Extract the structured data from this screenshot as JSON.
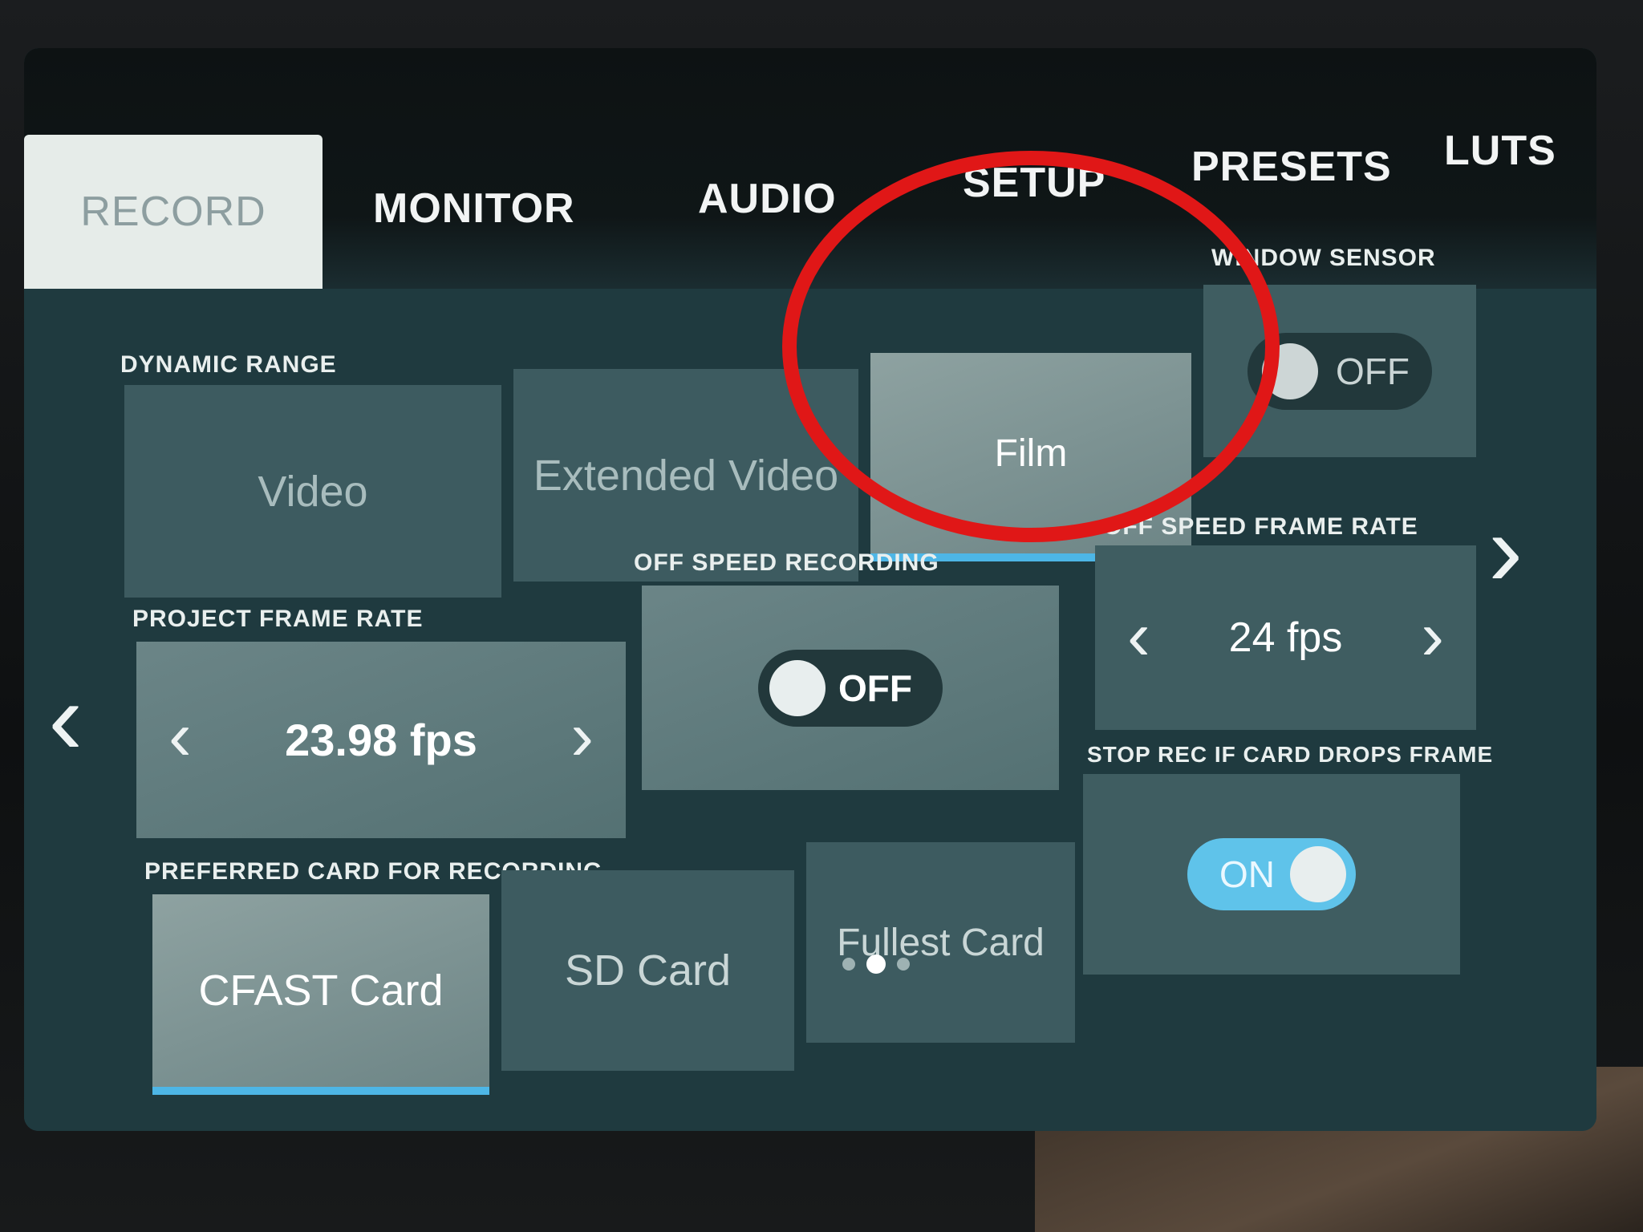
{
  "tabs": [
    {
      "label": "RECORD",
      "active": true
    },
    {
      "label": "MONITOR",
      "active": false
    },
    {
      "label": "AUDIO",
      "active": false
    },
    {
      "label": "SETUP",
      "active": false
    },
    {
      "label": "PRESETS",
      "active": false
    },
    {
      "label": "LUTS",
      "active": false
    }
  ],
  "dynamic_range": {
    "label": "DYNAMIC RANGE",
    "options": [
      "Video",
      "Extended Video",
      "Film"
    ],
    "selected": "Film"
  },
  "window_sensor": {
    "label": "WINDOW SENSOR",
    "state": "OFF"
  },
  "project_frame_rate": {
    "label": "PROJECT FRAME RATE",
    "value": "23.98 fps"
  },
  "off_speed_recording": {
    "label": "OFF SPEED RECORDING",
    "state": "OFF"
  },
  "off_speed_frame_rate": {
    "label": "OFF SPEED FRAME RATE",
    "value": "24 fps"
  },
  "stop_rec": {
    "label": "STOP REC IF CARD DROPS FRAME",
    "state": "ON"
  },
  "preferred_card": {
    "label": "PREFERRED CARD FOR RECORDING",
    "options": [
      "CFAST Card",
      "SD Card",
      "Fullest Card"
    ],
    "selected": "CFAST Card"
  },
  "pagination": {
    "pages": 3,
    "current": 2
  },
  "colors": {
    "accent": "#4db6e6",
    "highlight": "#e01717",
    "toggle_on": "#5fc3ea"
  }
}
